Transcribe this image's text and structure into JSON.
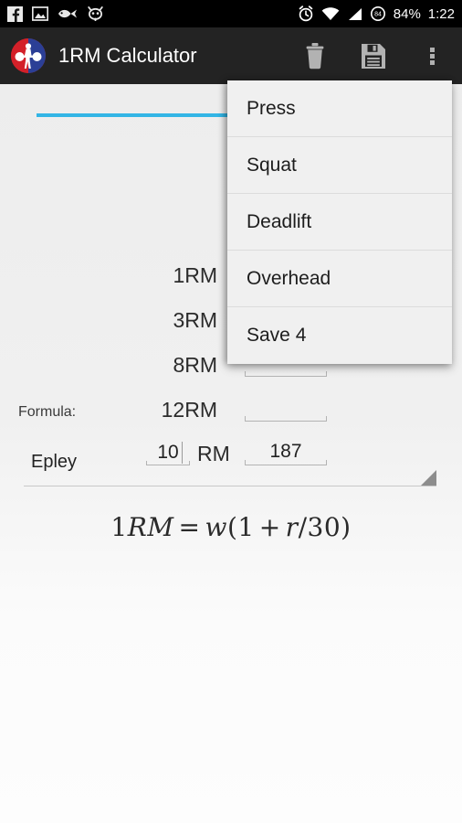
{
  "status_bar": {
    "icons_left": [
      "facebook-icon",
      "photo-icon",
      "fish-icon",
      "cyanogen-cat-icon"
    ],
    "icons_right": [
      "alarm-icon",
      "wifi-icon",
      "signal-icon",
      "battery-icon"
    ],
    "battery_level": "84",
    "battery_percent": "84%",
    "time": "1:22"
  },
  "action_bar": {
    "title": "1RM Calculator",
    "logo": "weightlifter-logo",
    "actions": [
      {
        "name": "delete-button",
        "icon": "trash-icon"
      },
      {
        "name": "save-button",
        "icon": "floppy-disk-icon"
      },
      {
        "name": "overflow-button",
        "icon": "more-vert-icon"
      }
    ]
  },
  "main": {
    "weight_input": {
      "value": "",
      "focused": true
    },
    "rows": [
      {
        "label": "1RM",
        "value": ""
      },
      {
        "label": "3RM",
        "value": ""
      },
      {
        "label": "8RM",
        "value": ""
      },
      {
        "label": "12RM",
        "value": ""
      }
    ],
    "custom_row": {
      "reps": "10",
      "suffix": "RM",
      "value": "187"
    },
    "formula": {
      "label": "Formula:",
      "selected": "Epley",
      "equation": {
        "lhs_num": "1",
        "lhs_var": "RM",
        "eq": "=",
        "w": "w",
        "open": "(",
        "one": "1",
        "plus": "+",
        "r": "r",
        "slash": "/",
        "thirty": "30",
        "close": ")"
      }
    }
  },
  "overflow_menu": {
    "items": [
      {
        "label": "Press"
      },
      {
        "label": "Squat"
      },
      {
        "label": "Deadlift"
      },
      {
        "label": "Overhead"
      },
      {
        "label": "Save 4"
      }
    ]
  },
  "colors": {
    "accent": "#33b5e5",
    "action_bar": "#232323",
    "status_bar": "#000000",
    "logo_red": "#d32029",
    "logo_blue": "#2b3f96"
  }
}
